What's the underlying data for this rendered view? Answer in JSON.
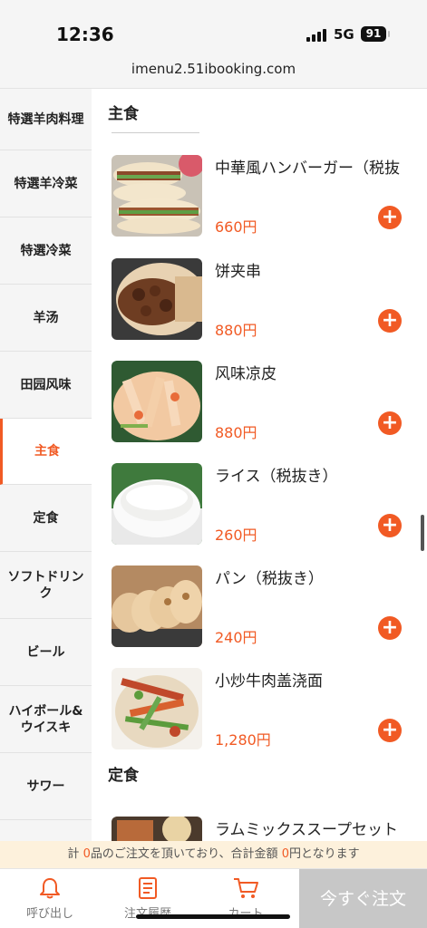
{
  "status": {
    "time": "12:36",
    "network": "5G",
    "battery": "91"
  },
  "url": "imenu2.51ibooking.com",
  "sidebar": {
    "items": [
      {
        "label": "特選羊肉料理"
      },
      {
        "label": "特選羊冷菜"
      },
      {
        "label": "特選冷菜"
      },
      {
        "label": "羊汤"
      },
      {
        "label": "田园风味"
      },
      {
        "label": "主食"
      },
      {
        "label": "定食"
      },
      {
        "label": "ソフトドリンク"
      },
      {
        "label": "ビール"
      },
      {
        "label": "ハイボール&ウイスキ"
      },
      {
        "label": "サワー"
      }
    ],
    "active_index": 5
  },
  "main": {
    "section_title": "主食",
    "items": [
      {
        "name": "中華風ハンバーガー（税抜",
        "price": "660円",
        "icon": "plus-icon"
      },
      {
        "name": "饼夹串",
        "price": "880円",
        "icon": "plus-icon"
      },
      {
        "name": "风味凉皮",
        "price": "880円",
        "icon": "plus-icon"
      },
      {
        "name": "ライス（税抜き）",
        "price": "260円",
        "icon": "plus-icon"
      },
      {
        "name": "パン（税抜き）",
        "price": "240円",
        "icon": "plus-icon"
      },
      {
        "name": "小炒牛肉盖浇面",
        "price": "1,280円",
        "icon": "plus-icon"
      }
    ],
    "section2_title": "定食",
    "section2_items": [
      {
        "name": "ラムミックススープセット"
      }
    ]
  },
  "summary": {
    "prefix": "計",
    "count": "0",
    "middle": "品のご注文を頂いており、合計金額",
    "amount": "0",
    "suffix": "円となります"
  },
  "nav": {
    "call": "呼び出し",
    "history": "注文履歴",
    "cart": "カート",
    "order_now": "今すぐ注文"
  },
  "colors": {
    "accent": "#f15a24",
    "summary_bg": "#fdf1dc",
    "order_btn": "#c7c7c7"
  }
}
